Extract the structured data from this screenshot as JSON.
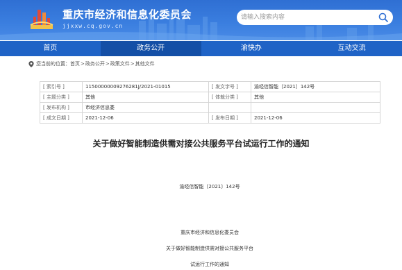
{
  "header": {
    "site_title": "重庆市经济和信息化委员会",
    "site_url": "jjxxw.cq.gov.cn",
    "search_placeholder": "请输入搜索内容",
    "search_icon": "search-icon",
    "logo_icon": "emblem-logo",
    "colors": {
      "header_blue": "#3b7fe0",
      "nav_blue": "#1f63c6",
      "nav_active": "#144fa6"
    }
  },
  "nav": {
    "items": [
      "首页",
      "政务公开",
      "渝快办",
      "互动交流"
    ],
    "active": "政务公开"
  },
  "breadcrumb": {
    "prefix": "您当前的位置：",
    "items": [
      "首页",
      "政务公开",
      "政策文件",
      "其他文件"
    ],
    "separator": ">"
  },
  "meta": {
    "rows": [
      {
        "k1": "[ 索引号 ]",
        "v1": "11500000009276281J/2021-01015",
        "k2": "[ 发文字号 ]",
        "v2": "渝经信智能〔2021〕142号"
      },
      {
        "k1": "[ 主题分类 ]",
        "v1": "其他",
        "k2": "[ 体裁分类 ]",
        "v2": "其他"
      },
      {
        "k1": "[ 发布机构 ]",
        "v1": "市经济信息委",
        "k2": "",
        "v2": ""
      },
      {
        "k1": "[ 成文日期 ]",
        "v1": "2021-12-06",
        "k2": "[ 发布日期 ]",
        "v2": "2021-12-06"
      }
    ]
  },
  "document": {
    "title": "关于做好智能制造供需对接公共服务平台试运行工作的通知",
    "number": "渝经信智能〔2021〕142号",
    "sender": "重庆市经济和信息化委员会",
    "line1": "关于做好智能制造供需对接公共服务平台",
    "line2": "试运行工作的通知"
  }
}
